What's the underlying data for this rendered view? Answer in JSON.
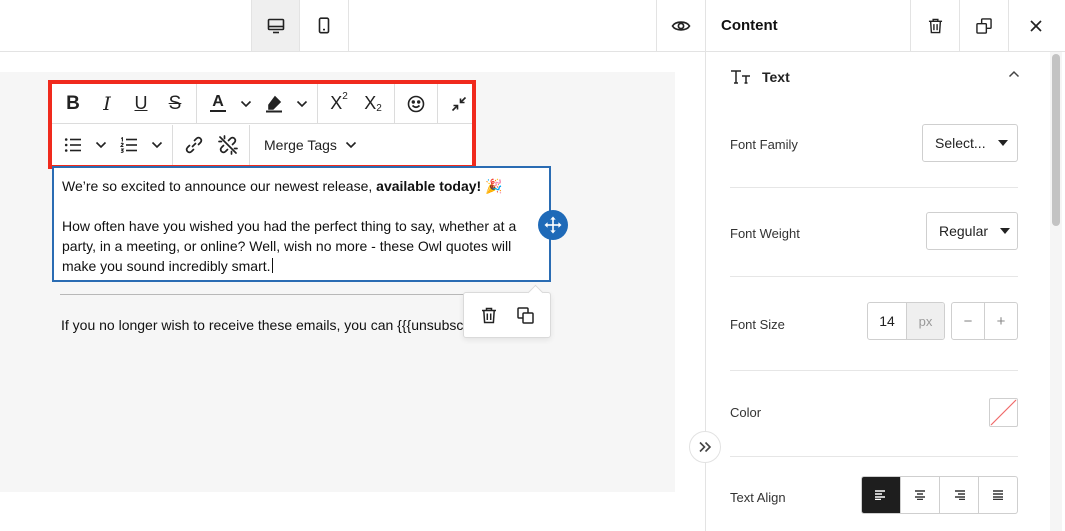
{
  "topbar": {
    "desktop_icon": "desktop-icon",
    "mobile_icon": "mobile-icon",
    "preview_icon": "eye-icon"
  },
  "toolbar": {
    "bold": "B",
    "italic": "I",
    "underline": "U",
    "strikethrough": "S",
    "font_color": "A",
    "superscript_base": "X",
    "superscript_mark": "2",
    "subscript_base": "X",
    "subscript_mark": "2",
    "merge_tags_label": "Merge Tags"
  },
  "content": {
    "line1_text": "We’re so excited to announce our newest release, ",
    "line1_bold": "available today!",
    "line1_emoji": "🎉",
    "paragraph2": "How often have you wished you had the perfect thing to say, whether at a party, in a meeting, or online? Well, wish no more - these Owl quotes will make you sound incredibly smart.",
    "footer": "If you no longer wish to receive these emails, you can {{{unsubscribe"
  },
  "panel": {
    "title": "Content",
    "section_title": "Text",
    "font_family": {
      "label": "Font Family",
      "value": "Select..."
    },
    "font_weight": {
      "label": "Font Weight",
      "value": "Regular"
    },
    "font_size": {
      "label": "Font Size",
      "value": "14",
      "unit": "px",
      "decrement": "−",
      "increment": "+"
    },
    "color": {
      "label": "Color"
    },
    "text_align": {
      "label": "Text Align",
      "options": [
        "left",
        "center",
        "right",
        "justify"
      ],
      "selected": "left"
    }
  },
  "colors": {
    "toolbar_highlight": "#f02a1d",
    "selection_border": "#2a6cb3",
    "move_handle": "#1f6ab8",
    "active_align": "#1e1e1e"
  }
}
